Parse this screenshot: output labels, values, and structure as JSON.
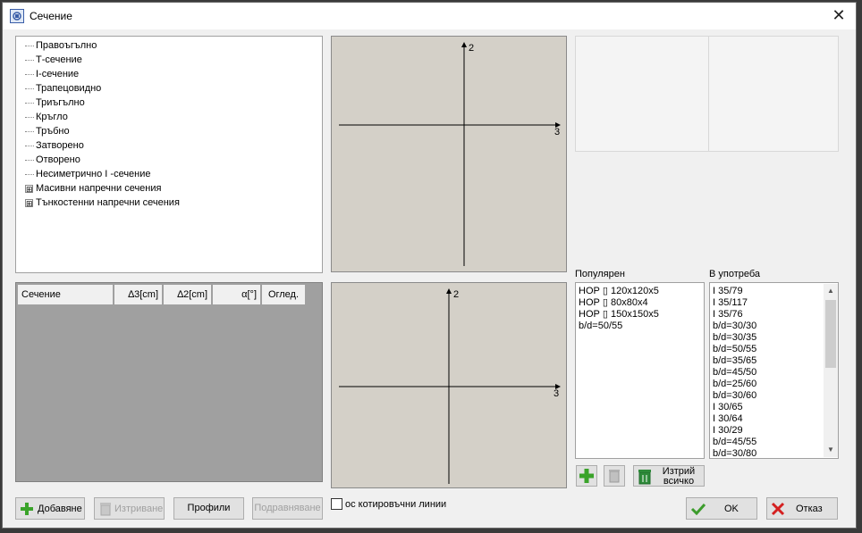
{
  "window": {
    "title": "Сечение",
    "close_label": "✕"
  },
  "tree": {
    "items": [
      {
        "label": "Правоъгълно"
      },
      {
        "label": "Т-сечение"
      },
      {
        "label": "I-сечение"
      },
      {
        "label": "Трапецовидно"
      },
      {
        "label": "Триъгълно"
      },
      {
        "label": "Кръгло"
      },
      {
        "label": "Тръбно"
      },
      {
        "label": "Затворено"
      },
      {
        "label": "Отворено"
      },
      {
        "label": "Несиметрично I -сечение"
      },
      {
        "label": "Масивни напречни сечения",
        "expander": "⊞"
      },
      {
        "label": "Тънкостенни напречни сечения",
        "expander": "⊞"
      }
    ]
  },
  "grid": {
    "columns": [
      "Сечение",
      "∆3[cm]",
      "∆2[cm]",
      "α[°]",
      "Оглед."
    ]
  },
  "preview": {
    "top": {
      "axis_v": "2",
      "axis_h": "3"
    },
    "bottom": {
      "axis_v": "2",
      "axis_h": "3"
    }
  },
  "popular": {
    "label": "Популярен",
    "items": [
      "НОР ▯ 120x120x5",
      "НОР ▯ 80x80x4",
      "НОР ▯ 150x150x5",
      "b/d=50/55"
    ]
  },
  "in_use": {
    "label": "В употреба",
    "items": [
      "I 35/79",
      "I 35/117",
      "I 35/76",
      "b/d=30/30",
      "b/d=30/35",
      "b/d=50/55",
      "b/d=35/65",
      "b/d=45/50",
      "b/d=25/60",
      "b/d=30/60",
      "I 30/65",
      "I 30/64",
      "I 30/29",
      "b/d=45/55",
      "b/d=30/80"
    ],
    "scroll_up": "▲",
    "scroll_down": "▼"
  },
  "buttons": {
    "add": "Добавяне",
    "delete": "Изтриване",
    "profiles": "Профили",
    "align": "Подравняване",
    "delete_all_line1": "Изтрий",
    "delete_all_line2": "всичко",
    "ok": "OK",
    "cancel": "Отказ"
  },
  "checkbox": {
    "label": "ос котировъчни линии",
    "checked": false
  },
  "colors": {
    "add_green": "#3aa32a",
    "cancel_red": "#d42020",
    "ok_green": "#3c9c2c",
    "canvas_bg": "#d4d0c8",
    "grid_bg": "#a0a0a0"
  }
}
